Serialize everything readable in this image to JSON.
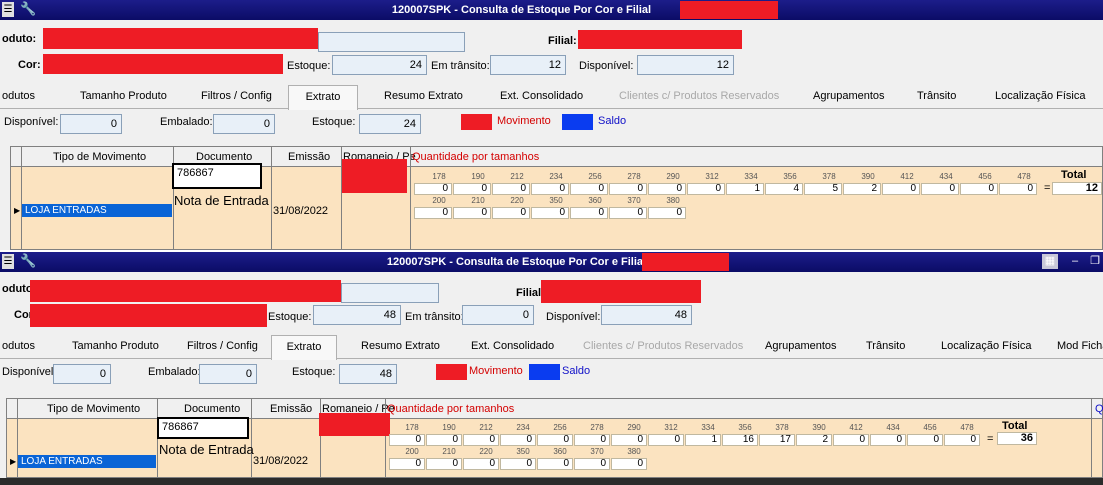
{
  "windows": [
    {
      "title": "120007SPK - Consulta de Estoque Por Cor e Filial",
      "labels": {
        "produto": "oduto:",
        "filial": "Filial:",
        "cor": "Cor:",
        "estoque": "Estoque:",
        "transito": "Em trânsito:",
        "disponivel": "Disponível:"
      },
      "values": {
        "estoque": "24",
        "transito": "12",
        "disponivel": "12"
      },
      "tabs": [
        "odutos",
        "Tamanho Produto",
        "Filtros / Config",
        "Extrato",
        "Resumo Extrato",
        "Ext. Consolidado",
        "Clientes c/ Produtos Reservados",
        "Agrupamentos",
        "Trânsito",
        "Localização Física"
      ],
      "summary": {
        "disponivel_label": "Disponível:",
        "disponivel": "0",
        "embalado_label": "Embalado:",
        "embalado": "0",
        "estoque_label": "Estoque:",
        "estoque": "24"
      },
      "legend": {
        "movimento": "Movimento",
        "saldo": "Saldo"
      },
      "grid": {
        "headers": [
          "Tipo de Movimento",
          "Documento",
          "Emissão",
          "Romaneio / Pe",
          "Quantidade por tamanhos"
        ],
        "row": {
          "tipo": "LOJA ENTRADAS",
          "documento": "786867",
          "nota": "Nota de Entrada",
          "emissao": "31/08/2022",
          "sizes1": [
            "178",
            "190",
            "212",
            "234",
            "256",
            "278",
            "290",
            "312",
            "334",
            "356",
            "378",
            "390",
            "412",
            "434",
            "456",
            "478"
          ],
          "qty1": [
            "0",
            "0",
            "0",
            "0",
            "0",
            "0",
            "0",
            "0",
            "1",
            "4",
            "5",
            "2",
            "0",
            "0",
            "0",
            "0"
          ],
          "sizes2": [
            "200",
            "210",
            "220",
            "350",
            "360",
            "370",
            "380"
          ],
          "qty2": [
            "0",
            "0",
            "0",
            "0",
            "0",
            "0",
            "0"
          ],
          "eq": "=",
          "total_label": "Total",
          "total": "12"
        }
      }
    },
    {
      "title": "120007SPK - Consulta de Estoque Por Cor e Filial",
      "labels": {
        "produto": "oduto",
        "filial": "Filial:",
        "cor": "Cor",
        "estoque": "Estoque:",
        "transito": "Em trânsito:",
        "disponivel": "Disponível:"
      },
      "values": {
        "estoque": "48",
        "transito": "0",
        "disponivel": "48"
      },
      "tabs": [
        "odutos",
        "Tamanho Produto",
        "Filtros / Config",
        "Extrato",
        "Resumo Extrato",
        "Ext. Consolidado",
        "Clientes c/ Produtos Reservados",
        "Agrupamentos",
        "Trânsito",
        "Localização Física",
        "Mod Ficha"
      ],
      "summary": {
        "disponivel_label": "Disponível:",
        "disponivel": "0",
        "embalado_label": "Embalado:",
        "embalado": "0",
        "estoque_label": "Estoque:",
        "estoque": "48"
      },
      "legend": {
        "movimento": "Movimento",
        "saldo": "Saldo"
      },
      "grid": {
        "headers": [
          "Tipo de Movimento",
          "Documento",
          "Emissão",
          "Romaneio / Pe",
          "Quantidade por tamanhos"
        ],
        "extra_col": "Q",
        "row": {
          "tipo": "LOJA ENTRADAS",
          "documento": "786867",
          "nota": "Nota de Entrada",
          "emissao": "31/08/2022",
          "sizes1": [
            "178",
            "190",
            "212",
            "234",
            "256",
            "278",
            "290",
            "312",
            "334",
            "356",
            "378",
            "390",
            "412",
            "434",
            "456",
            "478"
          ],
          "qty1": [
            "0",
            "0",
            "0",
            "0",
            "0",
            "0",
            "0",
            "0",
            "1",
            "16",
            "17",
            "2",
            "0",
            "0",
            "0",
            "0"
          ],
          "sizes2": [
            "200",
            "210",
            "220",
            "350",
            "360",
            "370",
            "380"
          ],
          "qty2": [
            "0",
            "0",
            "0",
            "0",
            "0",
            "0",
            "0"
          ],
          "eq": "=",
          "total_label": "Total",
          "total": "36"
        }
      }
    }
  ],
  "colors": {
    "titlebar": "#0b0c66",
    "movimento": "#ee1c25",
    "saldo": "#0a3cf0",
    "grid_bg": "#fbe3c0",
    "selection": "#0a64d6"
  },
  "icons": [
    "system-menu-icon",
    "wrench-icon",
    "grid-icon",
    "minimize-icon",
    "restore-icon"
  ]
}
